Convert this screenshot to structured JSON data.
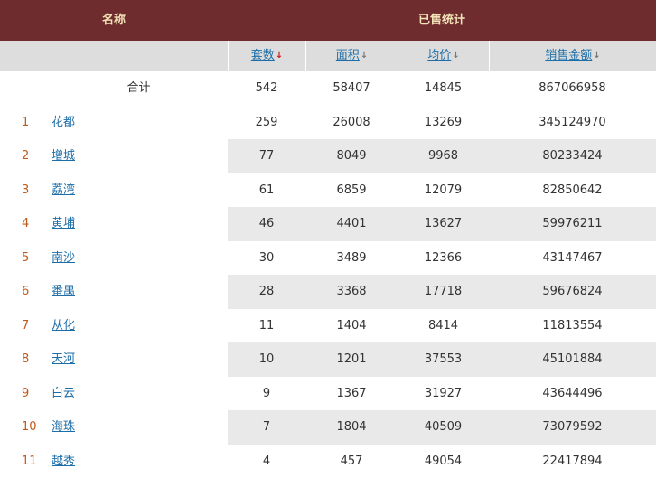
{
  "header": {
    "name_label": "名称",
    "sold_label": "已售统计"
  },
  "columns": {
    "count": {
      "label": "套数",
      "sort_icon": "sort-down-active"
    },
    "area": {
      "label": "面积",
      "sort_icon": "sort-down"
    },
    "avg_price": {
      "label": "均价",
      "sort_icon": "sort-down"
    },
    "sales": {
      "label": "销售金额",
      "sort_icon": "sort-down"
    }
  },
  "total": {
    "label": "合计",
    "count": "542",
    "area": "58407",
    "avg_price": "14845",
    "sales": "867066958"
  },
  "rows": [
    {
      "idx": "1",
      "name": "花都",
      "count": "259",
      "area": "26008",
      "avg_price": "13269",
      "sales": "345124970"
    },
    {
      "idx": "2",
      "name": "增城",
      "count": "77",
      "area": "8049",
      "avg_price": "9968",
      "sales": "80233424"
    },
    {
      "idx": "3",
      "name": "荔湾",
      "count": "61",
      "area": "6859",
      "avg_price": "12079",
      "sales": "82850642"
    },
    {
      "idx": "4",
      "name": "黄埔",
      "count": "46",
      "area": "4401",
      "avg_price": "13627",
      "sales": "59976211"
    },
    {
      "idx": "5",
      "name": "南沙",
      "count": "30",
      "area": "3489",
      "avg_price": "12366",
      "sales": "43147467"
    },
    {
      "idx": "6",
      "name": "番禺",
      "count": "28",
      "area": "3368",
      "avg_price": "17718",
      "sales": "59676824"
    },
    {
      "idx": "7",
      "name": "从化",
      "count": "11",
      "area": "1404",
      "avg_price": "8414",
      "sales": "11813554"
    },
    {
      "idx": "8",
      "name": "天河",
      "count": "10",
      "area": "1201",
      "avg_price": "37553",
      "sales": "45101884"
    },
    {
      "idx": "9",
      "name": "白云",
      "count": "9",
      "area": "1367",
      "avg_price": "31927",
      "sales": "43644496"
    },
    {
      "idx": "10",
      "name": "海珠",
      "count": "7",
      "area": "1804",
      "avg_price": "40509",
      "sales": "73079592"
    },
    {
      "idx": "11",
      "name": "越秀",
      "count": "4",
      "area": "457",
      "avg_price": "49054",
      "sales": "22417894"
    }
  ],
  "colors": {
    "header_bg": "#6e2c2e",
    "header_text": "#f3e2b8",
    "subheader_bg": "#dddddd",
    "link": "#1d6ea8",
    "index": "#c05a1a",
    "sort_active": "#cc1b1b",
    "alt_row_bg": "#e9e9e9"
  }
}
